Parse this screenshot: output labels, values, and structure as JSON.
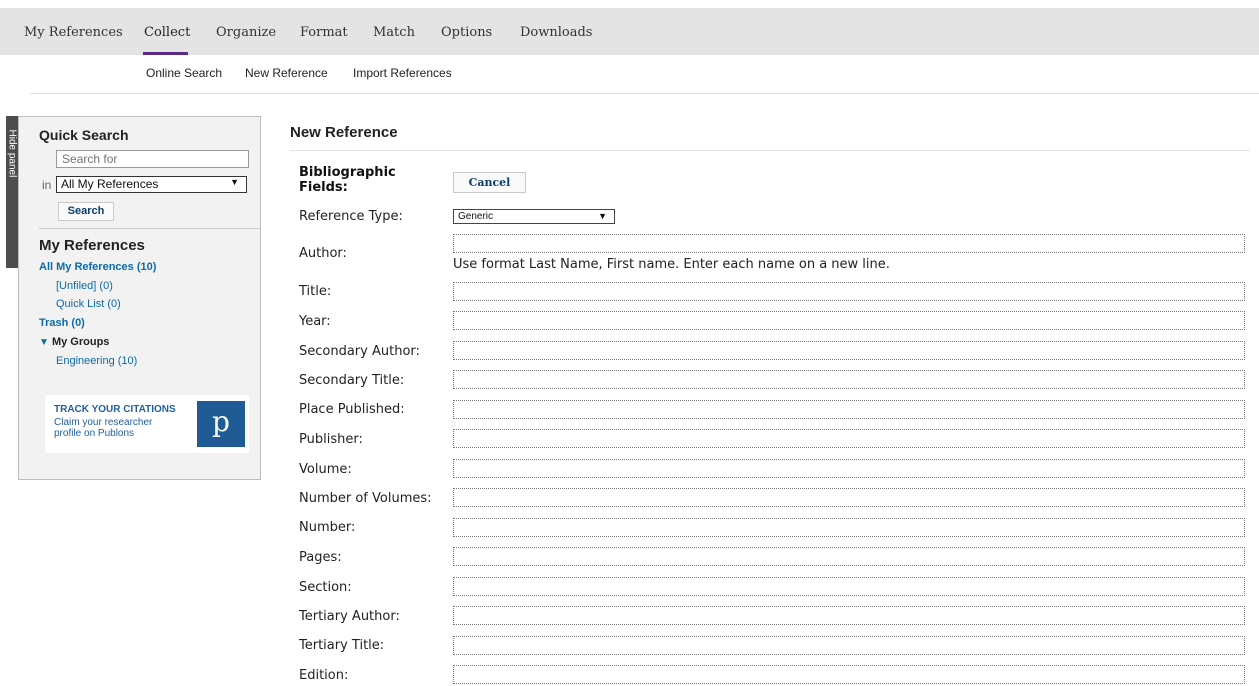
{
  "top_nav": {
    "tabs": [
      {
        "label": "My References"
      },
      {
        "label": "Collect",
        "active": true
      },
      {
        "label": "Organize"
      },
      {
        "label": "Format"
      },
      {
        "label": "Match"
      },
      {
        "label": "Options"
      },
      {
        "label": "Downloads"
      }
    ],
    "accent_color": "#5b2a86"
  },
  "sub_nav": {
    "online_search": "Online Search",
    "new_reference": "New Reference",
    "import_references": "Import References"
  },
  "side_panel": {
    "hide_panel_label": "Hide panel",
    "quick_search": {
      "title": "Quick Search",
      "search_placeholder": "Search for",
      "in_label": "in",
      "scope_value": "All My References",
      "search_button": "Search"
    },
    "my_references": {
      "title": "My References",
      "all": "All My References (10)",
      "unfiled": "[Unfiled] (0)",
      "quick_list": "Quick List (0)",
      "trash": "Trash (0)",
      "my_groups": "My Groups",
      "groups": [
        "Engineering (10)"
      ]
    },
    "promo": {
      "headline": "TRACK YOUR CITATIONS",
      "body": "Claim your researcher profile on Publons",
      "logo_letter": "p"
    }
  },
  "main": {
    "title": "New Reference",
    "bibliographic_fields": "Bibliographic Fields:",
    "cancel_button": "Cancel",
    "reference_type_label": "Reference Type:",
    "reference_type_value": "Generic",
    "author_label": "Author:",
    "author_hint": "Use format Last Name, First name. Enter each name on a new line.",
    "fields": [
      "Title:",
      "Year:",
      "Secondary Author:",
      "Secondary Title:",
      "Place Published:",
      "Publisher:",
      "Volume:",
      "Number of Volumes:",
      "Number:",
      "Pages:",
      "Section:",
      "Tertiary Author:",
      "Tertiary Title:",
      "Edition:"
    ]
  }
}
